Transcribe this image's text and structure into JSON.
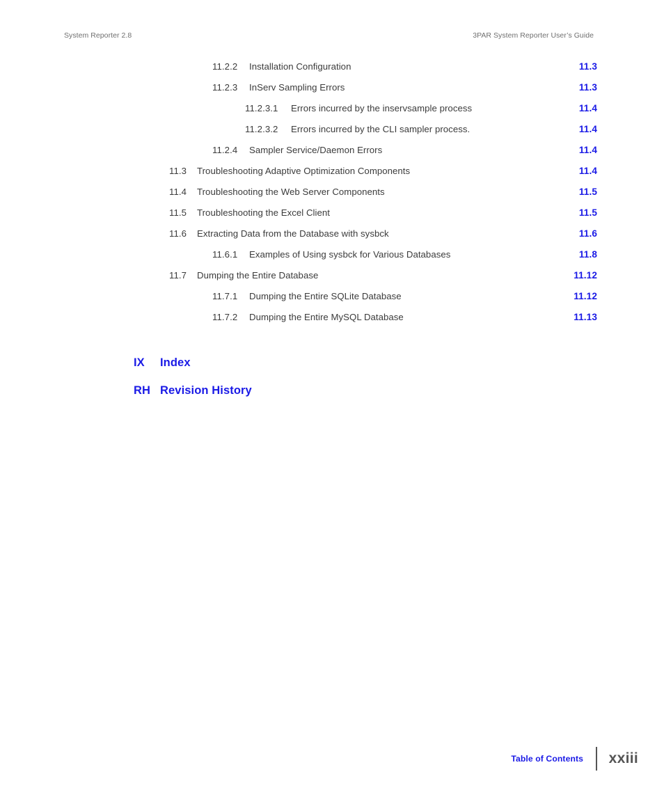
{
  "header": {
    "left": "System Reporter 2.8",
    "right": "3PAR System Reporter User’s Guide"
  },
  "toc": {
    "entries": [
      {
        "level": 3,
        "number": "11.2.2",
        "title": "Installation Configuration",
        "page": "11.3"
      },
      {
        "level": 3,
        "number": "11.2.3",
        "title": "InServ Sampling Errors",
        "page": "11.3"
      },
      {
        "level": 4,
        "number": "11.2.3.1",
        "title": "Errors incurred by the inservsample process",
        "page": "11.4"
      },
      {
        "level": 4,
        "number": "11.2.3.2",
        "title": "Errors incurred by the CLI sampler process.",
        "page": "11.4"
      },
      {
        "level": 3,
        "number": "11.2.4",
        "title": "Sampler Service/Daemon Errors",
        "page": "11.4"
      },
      {
        "level": 2,
        "number": "11.3",
        "title": "Troubleshooting Adaptive Optimization Components",
        "page": "11.4"
      },
      {
        "level": 2,
        "number": "11.4",
        "title": "Troubleshooting the Web Server Components",
        "page": "11.5"
      },
      {
        "level": 2,
        "number": "11.5",
        "title": "Troubleshooting the Excel Client",
        "page": "11.5"
      },
      {
        "level": 2,
        "number": "11.6",
        "title": "Extracting Data from the Database with sysbck",
        "page": "11.6"
      },
      {
        "level": 3,
        "number": "11.6.1",
        "title": "Examples of Using sysbck for Various Databases",
        "page": "11.8"
      },
      {
        "level": 2,
        "number": "11.7",
        "title": "Dumping the Entire Database",
        "page": "11.12"
      },
      {
        "level": 3,
        "number": "11.7.1",
        "title": "Dumping the Entire SQLite Database",
        "page": "11.12"
      },
      {
        "level": 3,
        "number": "11.7.2",
        "title": "Dumping the Entire MySQL Database",
        "page": "11.13"
      }
    ],
    "front_matter": [
      {
        "number": "IX",
        "title": "Index"
      },
      {
        "number": "RH",
        "title": "Revision History"
      }
    ]
  },
  "footer": {
    "label": "Table of Contents",
    "folio": "xxiii"
  },
  "colors": {
    "link_blue": "#1a1ae6",
    "body_text": "#3b3b3b",
    "header_gray": "#6f6f6f",
    "rule_gray": "#555555"
  }
}
